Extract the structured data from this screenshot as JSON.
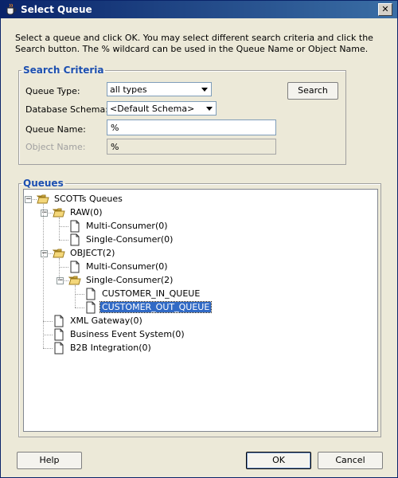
{
  "window": {
    "title": "Select Queue"
  },
  "instructions": "Select a queue and click OK. You may select different search criteria and click the Search button. The % wildcard can be used in the Queue Name or Object Name.",
  "search_criteria": {
    "title": "Search Criteria",
    "queue_type_label": "Queue Type:",
    "queue_type_value": "all types",
    "schema_label": "Database Schema:",
    "schema_value": "<Default Schema>",
    "queue_name_label": "Queue Name:",
    "queue_name_value": "%",
    "object_name_label": "Object Name:",
    "object_name_value": "%",
    "search_button": "Search"
  },
  "queues": {
    "title": "Queues",
    "tree": [
      {
        "label": "SCOTTs Queues",
        "type": "folder",
        "expanded": true,
        "level": 0
      },
      {
        "label": "RAW(0)",
        "type": "folder",
        "expanded": true,
        "level": 1
      },
      {
        "label": "Multi-Consumer(0)",
        "type": "file",
        "level": 2
      },
      {
        "label": "Single-Consumer(0)",
        "type": "file",
        "level": 2
      },
      {
        "label": "OBJECT(2)",
        "type": "folder",
        "expanded": true,
        "level": 1
      },
      {
        "label": "Multi-Consumer(0)",
        "type": "file",
        "level": 2
      },
      {
        "label": "Single-Consumer(2)",
        "type": "folder",
        "expanded": true,
        "level": 2
      },
      {
        "label": "CUSTOMER_IN_QUEUE",
        "type": "file",
        "level": 3
      },
      {
        "label": "CUSTOMER_OUT_QUEUE",
        "type": "file",
        "level": 3,
        "selected": true
      },
      {
        "label": "XML Gateway(0)",
        "type": "file",
        "level": 1
      },
      {
        "label": "Business Event System(0)",
        "type": "file",
        "level": 1
      },
      {
        "label": "B2B Integration(0)",
        "type": "file",
        "level": 1
      }
    ]
  },
  "buttons": {
    "help": "Help",
    "ok": "OK",
    "cancel": "Cancel"
  },
  "colors": {
    "title_bar": "#0a246a",
    "group_title": "#1c4fb0",
    "selection": "#316ac5",
    "background": "#ece9d8"
  }
}
